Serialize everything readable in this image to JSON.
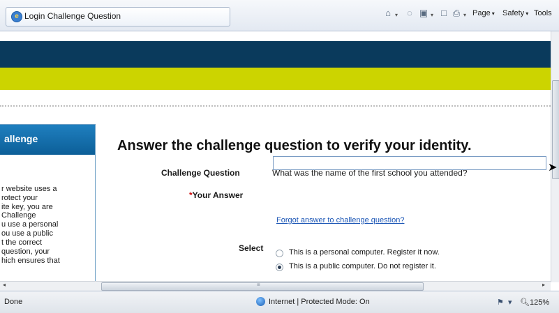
{
  "browser": {
    "tab_title": "Login Challenge Question",
    "menus": {
      "page": "Page",
      "safety": "Safety",
      "tools": "Tools"
    },
    "dropdown_glyph": "▾",
    "help_glyph": "?"
  },
  "page": {
    "colors": {
      "header_band": "#0a3a5c",
      "accent_band": "#ccd400",
      "sidebar_header": "#1f7fbf",
      "link": "#1a55b5"
    },
    "sidebar": {
      "title": "allenge",
      "lines": [
        "r website uses a",
        "rotect your",
        "ite  key, you are",
        "Challenge",
        "u use a personal",
        "ou use a public",
        "t the correct",
        "question, your",
        "hich ensures that"
      ]
    },
    "heading": "Answer the challenge question to verify your identity.",
    "challenge_label": "Challenge Question",
    "challenge_question": "What was the name of the first school you attended?",
    "answer_required_mark": "*",
    "answer_label": "Your Answer",
    "answer_value": "",
    "forgot_link": "Forgot answer to challenge question?",
    "select_label": "Select",
    "options": [
      {
        "label": "This is a personal computer. Register it now.",
        "selected": false
      },
      {
        "label": "This is a public computer. Do not register it.",
        "selected": true
      }
    ]
  },
  "statusbar": {
    "status": "Done",
    "zone": "Internet | Protected Mode: On",
    "zoom": "125%"
  }
}
